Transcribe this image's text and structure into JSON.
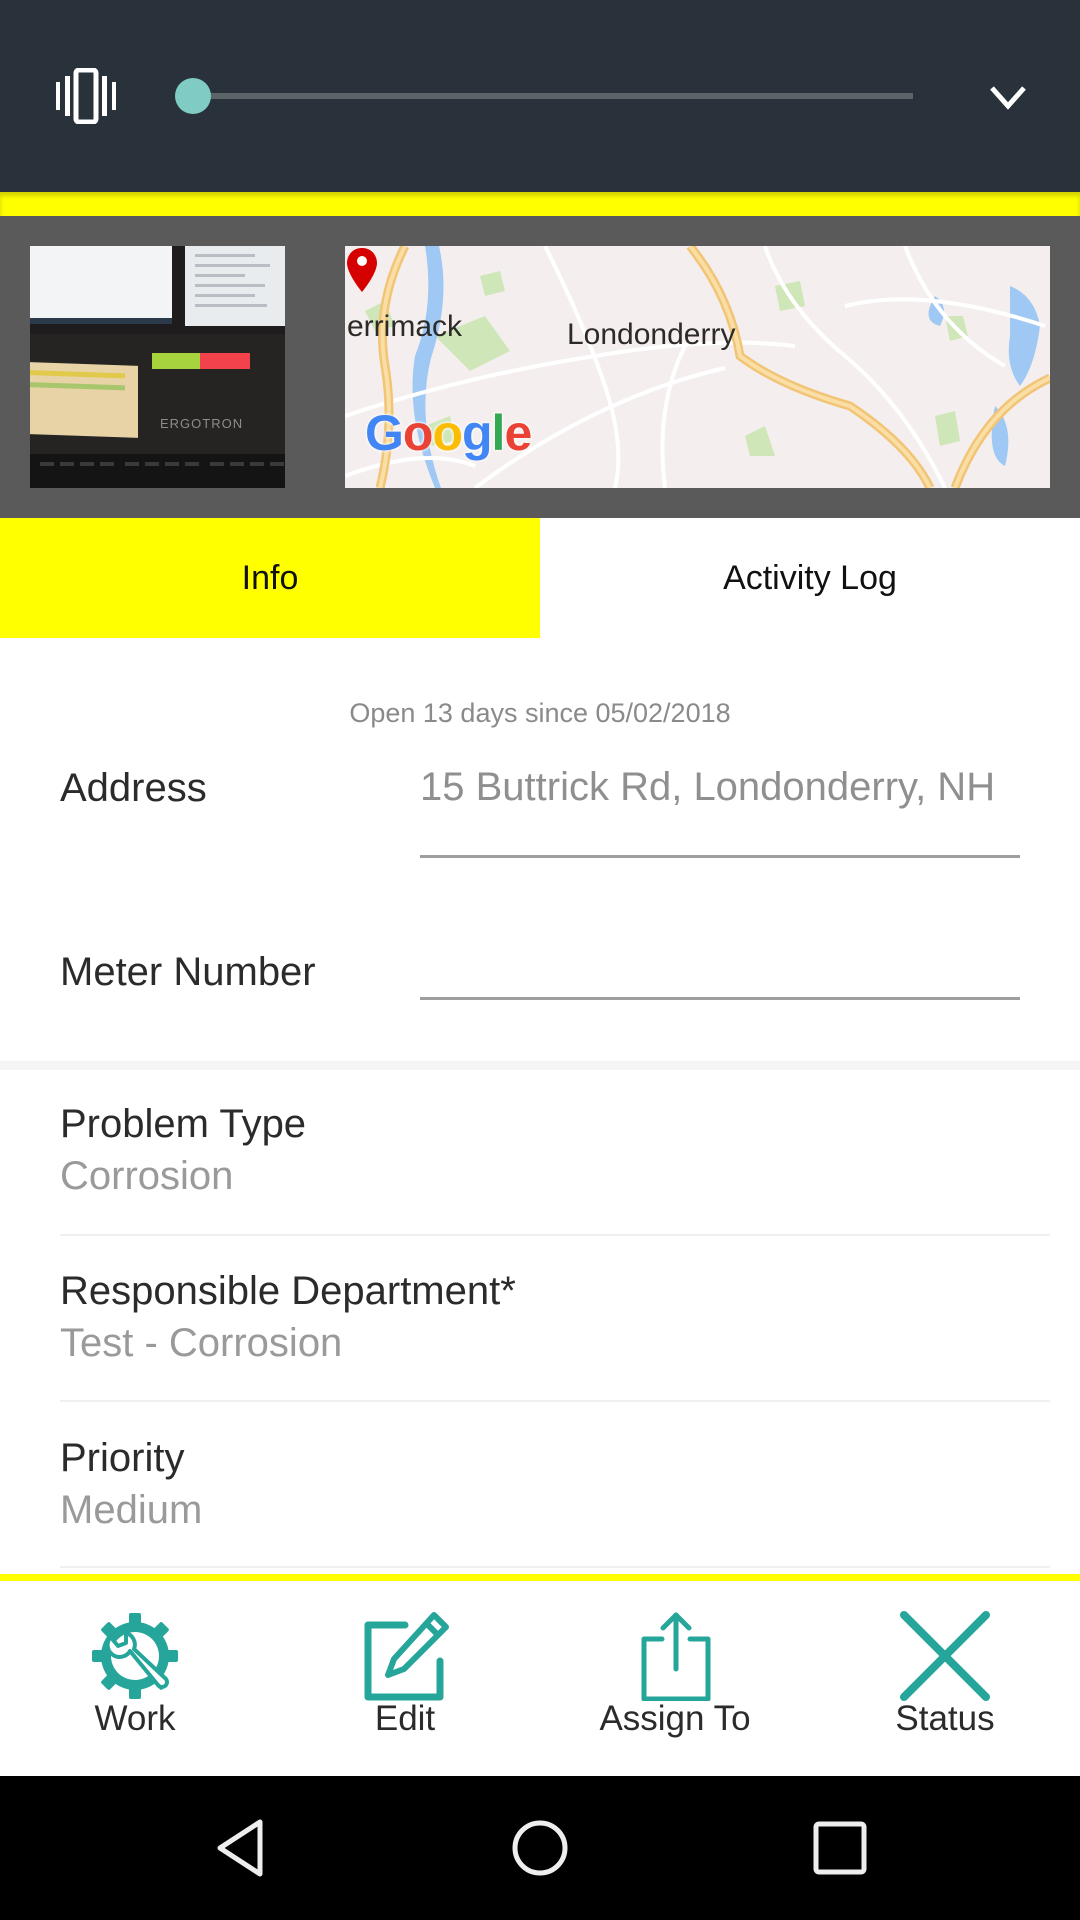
{
  "volume_panel": {
    "mode_icon": "vibrate-icon",
    "volume_level_percent": 0,
    "expand_icon": "chevron-down-icon"
  },
  "media": {
    "photo_alt": "Photo of desk with Ergotron monitor stand",
    "photo_brand_text": "ERGOTRON",
    "map": {
      "labels": [
        "errimack",
        "Londonderry"
      ],
      "attribution": "Google",
      "pin_icon": "map-pin-icon"
    }
  },
  "tabs": [
    {
      "label": "Info",
      "active": true
    },
    {
      "label": "Activity Log",
      "active": false
    }
  ],
  "info": {
    "open_since": "Open 13 days since 05/02/2018",
    "address_label": "Address",
    "address_value": "15 Buttrick Rd, Londonderry, NH",
    "meter_label": "Meter Number",
    "meter_value": "",
    "items": [
      {
        "title": "Problem Type",
        "value": "Corrosion"
      },
      {
        "title": "Responsible Department*",
        "value": "Test - Corrosion"
      },
      {
        "title": "Priority",
        "value": "Medium"
      }
    ]
  },
  "actions": [
    {
      "label": "Work",
      "icon": "gear-wrench-icon"
    },
    {
      "label": "Edit",
      "icon": "edit-pencil-icon"
    },
    {
      "label": "Assign To",
      "icon": "share-upload-icon"
    },
    {
      "label": "Status",
      "icon": "close-x-icon"
    }
  ],
  "navbar": {
    "back": "back-icon",
    "home": "home-icon",
    "recents": "recents-icon"
  },
  "colors": {
    "accent_yellow": "#ffff00",
    "teal": "#26a69a",
    "topbar": "#29323a",
    "slider_thumb": "#80cbc4"
  }
}
